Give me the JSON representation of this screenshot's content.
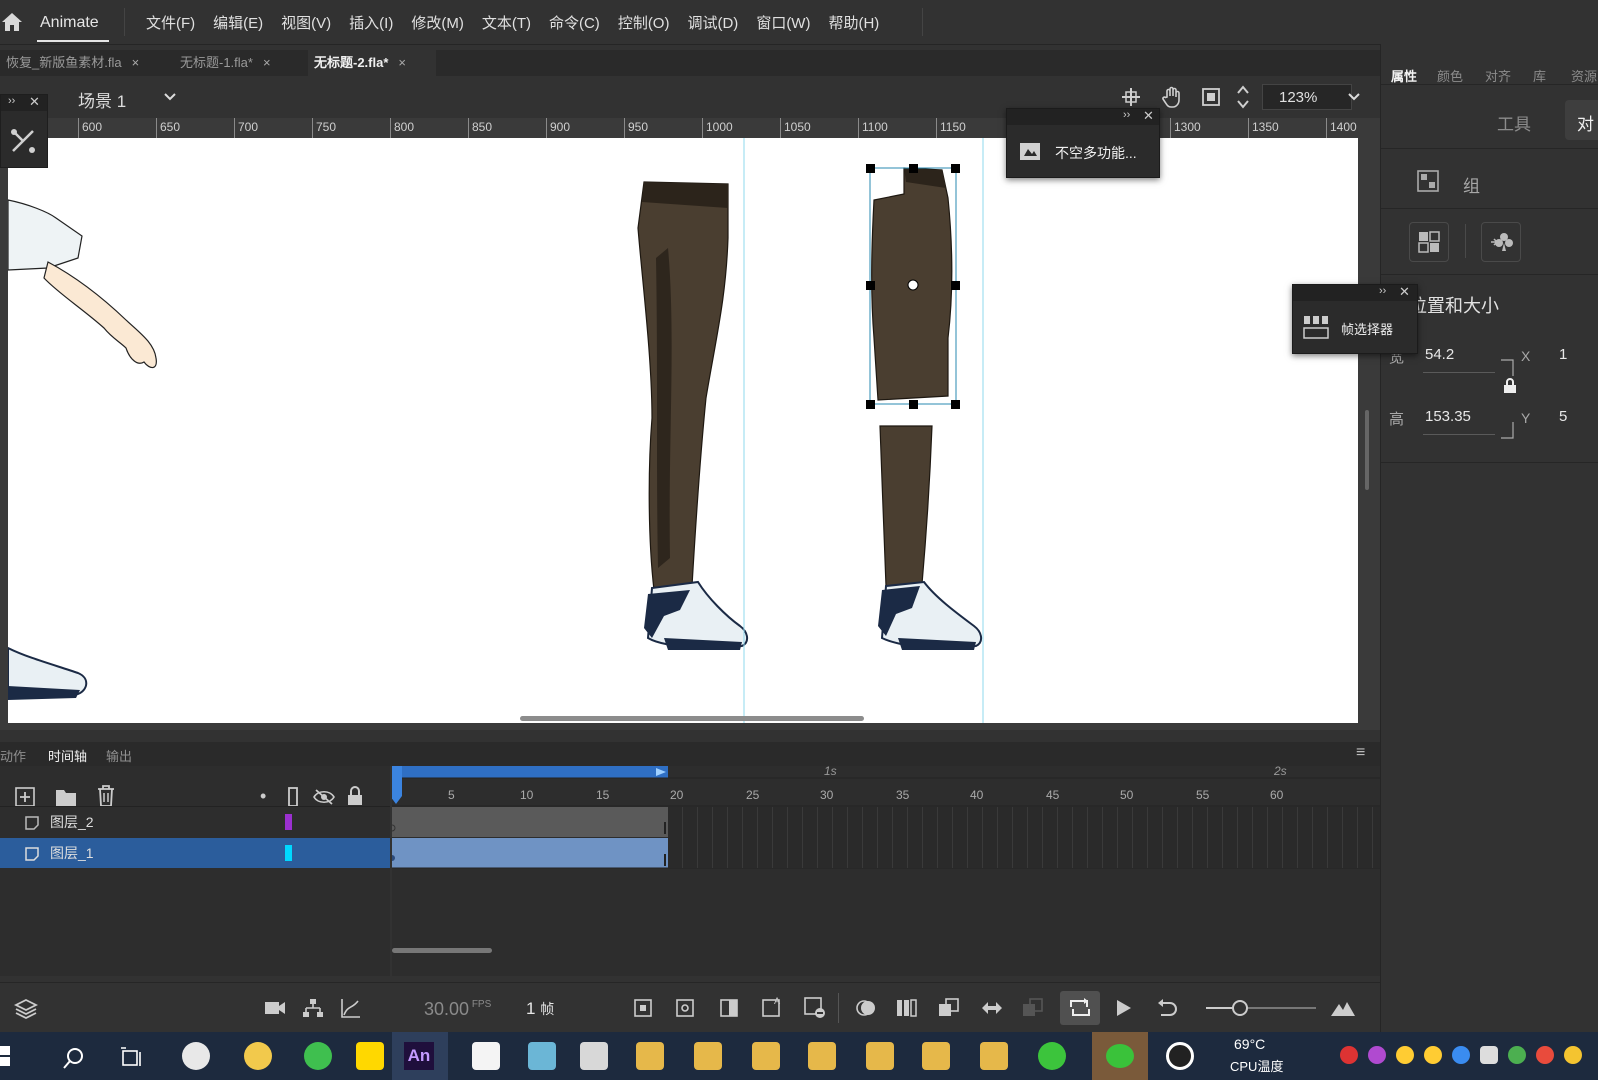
{
  "app": {
    "name": "Animate"
  },
  "menu": [
    "文件(F)",
    "编辑(E)",
    "视图(V)",
    "插入(I)",
    "修改(M)",
    "文本(T)",
    "命令(C)",
    "控制(O)",
    "调试(D)",
    "窗口(W)",
    "帮助(H)"
  ],
  "doc_tabs": [
    {
      "label": "恢复_新版鱼素材.fla",
      "active": false
    },
    {
      "label": "无标题-1.fla*",
      "active": false
    },
    {
      "label": "无标题-2.fla*",
      "active": true
    }
  ],
  "scene": {
    "label": "场景 1",
    "zoom": "123%"
  },
  "ruler": {
    "labels": [
      "600",
      "650",
      "700",
      "750",
      "800",
      "850",
      "900",
      "950",
      "1000",
      "1050",
      "1100",
      "1150",
      "1300",
      "1350",
      "1400"
    ]
  },
  "float_panels": {
    "more_features": "不空多功能...",
    "frame_picker": "帧选择器"
  },
  "timeline": {
    "tabs": [
      "动作",
      "时间轴",
      "输出"
    ],
    "active_tab": "时间轴",
    "layers": [
      {
        "name": "图层_2",
        "color": "#9b30d0",
        "selected": false
      },
      {
        "name": "图层_1",
        "color": "#00d8ff",
        "selected": true
      }
    ],
    "frame_numbers": [
      "5",
      "10",
      "15",
      "20",
      "25",
      "30",
      "35",
      "40",
      "45",
      "50",
      "55",
      "60"
    ],
    "seconds": [
      "1s",
      "2s"
    ],
    "span_end_frame": 19
  },
  "playback": {
    "fps": "30.00",
    "fps_unit": "FPS",
    "frame": "1",
    "frame_unit": "帧"
  },
  "properties": {
    "tabs": [
      "属性",
      "颜色",
      "对齐",
      "库",
      "资源"
    ],
    "active_tab": "属性",
    "mode_tab": "工具",
    "mode_tab_partial": "对",
    "object_type": "组",
    "section_title": "位置和大小",
    "width_label": "宽",
    "width_value": "54.2",
    "height_label": "高",
    "height_value": "153.35",
    "x_label": "X",
    "x_value": "1",
    "y_label": "Y",
    "y_value": "5"
  },
  "taskbar": {
    "temp_value": "69°C",
    "temp_label": "CPU温度",
    "an_label": "An"
  },
  "colors": {
    "accent": "#2b5d9c",
    "playhead": "#3b84e0",
    "pants": "#4a3e30",
    "shoe": "#1b2a45"
  }
}
